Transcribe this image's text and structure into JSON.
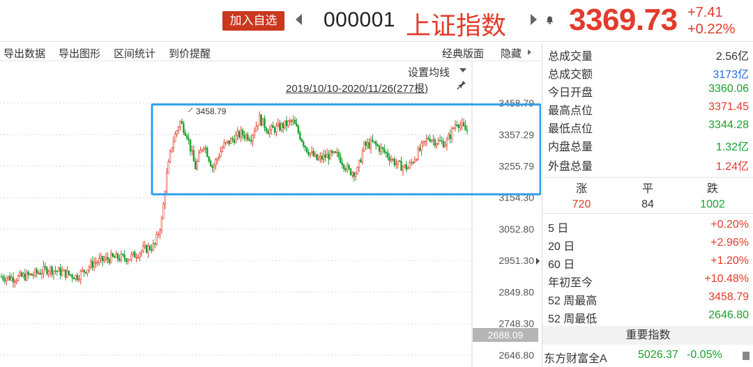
{
  "header": {
    "add_label": "加入自选",
    "code": "000001",
    "name": "上证指数",
    "price": "3369.73",
    "change": "+7.41",
    "change_pct": "+0.22%"
  },
  "toolbar": {
    "items": [
      "导出数据",
      "导出图形",
      "区间统计",
      "到价提醒"
    ],
    "right_items": [
      "经典版面",
      "隐藏"
    ]
  },
  "chart": {
    "avg_setting": "设置均线",
    "range_label": "2019/10/10-2020/11/26(277根)",
    "max_label": "3458.79",
    "current_tag": "2688.09",
    "up_color": "#e23b2a",
    "down_color": "#18a12e",
    "highlight_color": "#2f9fe8"
  },
  "chart_data": {
    "type": "candlestick",
    "y_ticks": [
      "3458.79",
      "3357.29",
      "3255.79",
      "3154.30",
      "3052.80",
      "2951.30",
      "2849.80",
      "2748.30",
      "2646.80"
    ],
    "ylim": [
      2646.8,
      3458.79
    ],
    "annotation_max": "3458.79",
    "range": "2019/10/10-2020/11/26(277根)"
  },
  "quote": {
    "rows": [
      {
        "label": "总成交量",
        "value": "2.56亿",
        "color": "#333333"
      },
      {
        "label": "总成交额",
        "value": "3173亿",
        "color": "#2b6fd6"
      },
      {
        "label": "今日开盘",
        "value": "3360.06",
        "color": "#18a12e"
      },
      {
        "label": "最高点位",
        "value": "3371.45",
        "color": "#e23b2a"
      },
      {
        "label": "最低点位",
        "value": "3344.28",
        "color": "#18a12e"
      },
      {
        "label": "内盘总量",
        "value": "1.32亿",
        "color": "#18a12e"
      },
      {
        "label": "外盘总量",
        "value": "1.24亿",
        "color": "#e23b2a"
      }
    ]
  },
  "breadth": {
    "up_label": "涨",
    "up_value": "720",
    "flat_label": "平",
    "flat_value": "84",
    "down_label": "跌",
    "down_value": "1002"
  },
  "periods": [
    {
      "label": "5 日",
      "value": "+0.20%"
    },
    {
      "label": "20 日",
      "value": "+2.96%"
    },
    {
      "label": "60 日",
      "value": "+1.20%"
    },
    {
      "label": "年初至今",
      "value": "+10.48%"
    },
    {
      "label": "52 周最高",
      "value": "3458.79"
    },
    {
      "label": "52 周最低",
      "value": "2646.80"
    }
  ],
  "important": {
    "title": "重要指数",
    "name": "东方财富全A",
    "value": "5026.37",
    "change": "-0.05%"
  }
}
